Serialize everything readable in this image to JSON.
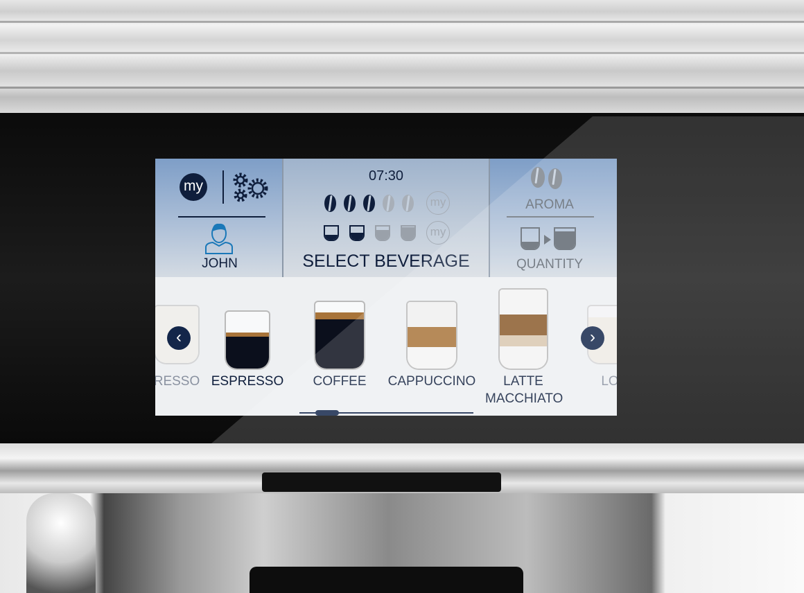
{
  "header": {
    "profile": {
      "my_label": "my",
      "user_name": "JOHN",
      "icon": "user-icon"
    },
    "settings": {
      "icon": "gears-icon"
    },
    "time": "07:30",
    "aroma_level": {
      "value": 3,
      "max": 5,
      "my_label": "my"
    },
    "quantity_level": {
      "value": 2,
      "max": 4,
      "my_label": "my"
    },
    "title": "SELECT BEVERAGE",
    "aroma": {
      "label": "AROMA",
      "icon": "coffee-beans-icon"
    },
    "quantity": {
      "label": "QUANTITY",
      "icon": "cup-size-icon"
    }
  },
  "beverages": [
    {
      "label": "RESSO",
      "partial": true
    },
    {
      "label": "ESPRESSO"
    },
    {
      "label": "COFFEE"
    },
    {
      "label": "CAPPUCCINO"
    },
    {
      "label": "LATTE MACCHIATO"
    },
    {
      "label": "LO",
      "partial": true
    }
  ],
  "carousel": {
    "prev_icon": "chevron-left-icon",
    "next_icon": "chevron-right-icon",
    "prev_glyph": "‹",
    "next_glyph": "›"
  },
  "colors": {
    "accent": "#0f1e3c",
    "user_icon": "#1a78b8",
    "crema": "#a8743a"
  }
}
